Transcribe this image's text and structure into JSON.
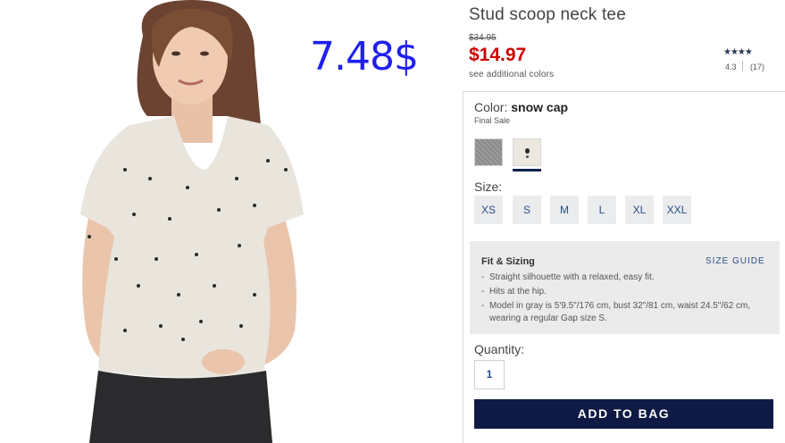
{
  "overlay": {
    "price": "7.48$"
  },
  "product": {
    "title": "Stud scoop neck tee",
    "original_price": "$34.95",
    "sale_price": "$14.97",
    "additional_colors_link": "see additional colors"
  },
  "rating": {
    "stars": "★★★★",
    "value": "4.3",
    "count": "(17)"
  },
  "color": {
    "label": "Color:",
    "selected": "snow cap",
    "note": "Final Sale",
    "swatches": [
      {
        "name": "gray",
        "color": "#929292"
      },
      {
        "name": "snow cap",
        "color": "#ece8df",
        "selected": true
      }
    ]
  },
  "size": {
    "label": "Size:",
    "options": [
      "XS",
      "S",
      "M",
      "L",
      "XL",
      "XXL"
    ]
  },
  "fit": {
    "title": "Fit & Sizing",
    "size_guide": "SIZE GUIDE",
    "bullets": [
      "Straight silhouette with a relaxed, easy fit.",
      "Hits at the hip.",
      "Model in gray is 5'9.5\"/176 cm, bust 32\"/81 cm, waist 24.5\"/62 cm, wearing a regular Gap size S."
    ]
  },
  "quantity": {
    "label": "Quantity:",
    "value": "1"
  },
  "add_to_bag": "ADD TO BAG",
  "colors": {
    "sale_red": "#cc0000",
    "navy": "#0e1a44",
    "link_blue": "#2a4f8a",
    "overlay_blue": "#1f1ff0"
  }
}
